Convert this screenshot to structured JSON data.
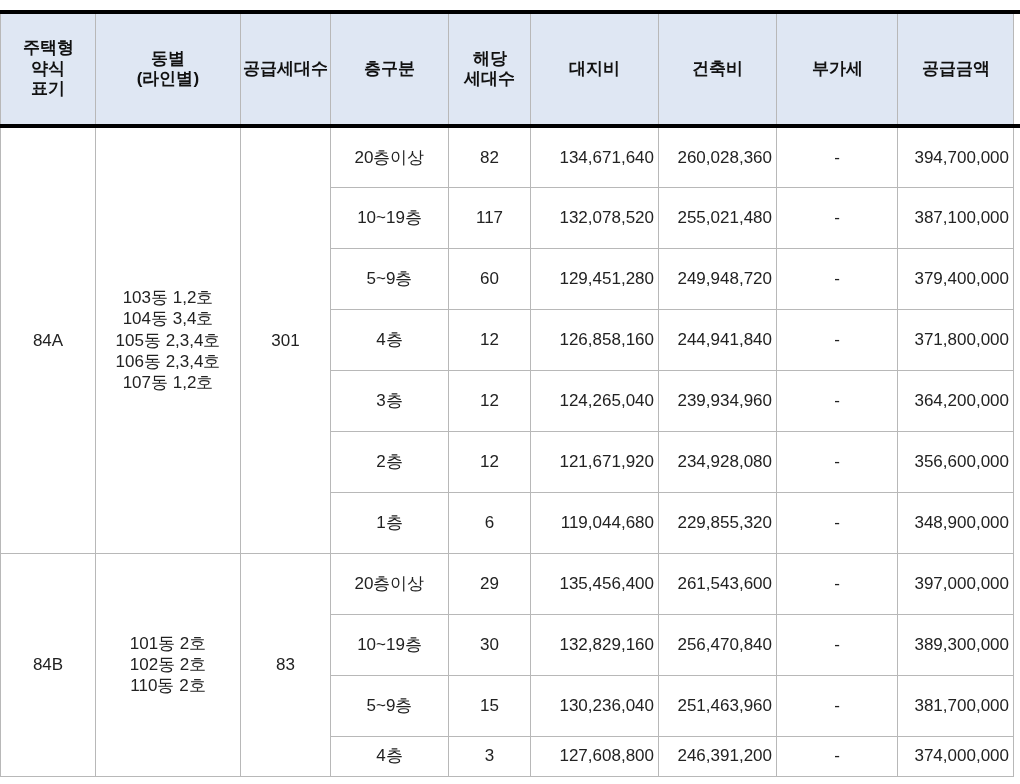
{
  "table": {
    "columns": [
      "주택형\n약식\n표기",
      "동별\n(라인별)",
      "공급세대수",
      "층구분",
      "해당\n세대수",
      "대지비",
      "건축비",
      "부가세",
      "공급금액"
    ],
    "groups": [
      {
        "type": "84A",
        "lines": [
          "103동 1,2호",
          "104동 3,4호",
          "105동 2,3,4호",
          "106동 2,3,4호",
          "107동 1,2호"
        ],
        "supply_count": "301",
        "rows": [
          {
            "floor": "20층이상",
            "units": "82",
            "land": "134,671,640",
            "building": "260,028,360",
            "vat": "-",
            "total": "394,700,000"
          },
          {
            "floor": "10~19층",
            "units": "117",
            "land": "132,078,520",
            "building": "255,021,480",
            "vat": "-",
            "total": "387,100,000"
          },
          {
            "floor": "5~9층",
            "units": "60",
            "land": "129,451,280",
            "building": "249,948,720",
            "vat": "-",
            "total": "379,400,000"
          },
          {
            "floor": "4층",
            "units": "12",
            "land": "126,858,160",
            "building": "244,941,840",
            "vat": "-",
            "total": "371,800,000"
          },
          {
            "floor": "3층",
            "units": "12",
            "land": "124,265,040",
            "building": "239,934,960",
            "vat": "-",
            "total": "364,200,000"
          },
          {
            "floor": "2층",
            "units": "12",
            "land": "121,671,920",
            "building": "234,928,080",
            "vat": "-",
            "total": "356,600,000"
          },
          {
            "floor": "1층",
            "units": "6",
            "land": "119,044,680",
            "building": "229,855,320",
            "vat": "-",
            "total": "348,900,000"
          }
        ]
      },
      {
        "type": "84B",
        "lines": [
          "101동 2호",
          "102동 2호",
          "110동 2호"
        ],
        "supply_count": "83",
        "rows": [
          {
            "floor": "20층이상",
            "units": "29",
            "land": "135,456,400",
            "building": "261,543,600",
            "vat": "-",
            "total": "397,000,000"
          },
          {
            "floor": "10~19층",
            "units": "30",
            "land": "132,829,160",
            "building": "256,470,840",
            "vat": "-",
            "total": "389,300,000"
          },
          {
            "floor": "5~9층",
            "units": "15",
            "land": "130,236,040",
            "building": "251,463,960",
            "vat": "-",
            "total": "381,700,000"
          },
          {
            "floor": "4층",
            "units": "3",
            "land": "127,608,800",
            "building": "246,391,200",
            "vat": "-",
            "total": "374,000,000"
          }
        ]
      }
    ]
  }
}
